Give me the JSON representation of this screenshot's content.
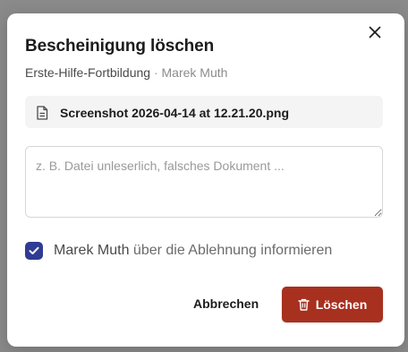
{
  "dialog": {
    "title": "Besch­einigung löschen",
    "subtitle_course": "Erste-Hilfe-Fortbildung",
    "subtitle_separator": "·",
    "subtitle_person": "Marek Muth"
  },
  "file": {
    "name": "Screenshot 2026-04-14 at 12.21.20.png",
    "icon": "document-icon"
  },
  "reason_field": {
    "value": "",
    "placeholder": "z. B. Datei unleserlich, falsches Dokument ..."
  },
  "notify": {
    "checked": true,
    "name": "Marek Muth",
    "text": "über die Ablehnung informieren"
  },
  "actions": {
    "cancel_label": "Abbrechen",
    "delete_label": "Löschen"
  },
  "colors": {
    "accent_checkbox": "#2f3c93",
    "danger": "#a8301f"
  }
}
